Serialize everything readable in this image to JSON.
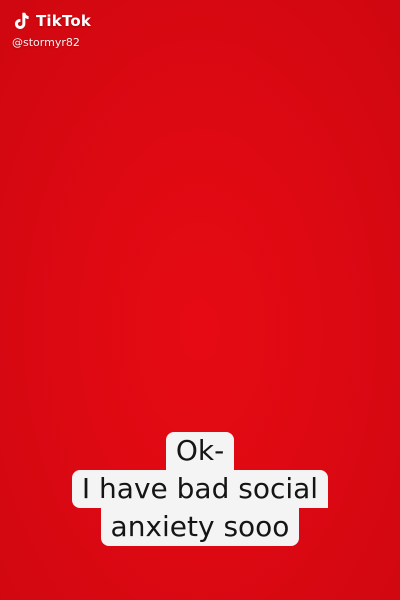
{
  "watermark": {
    "brand": "TikTok",
    "handle": "@stormyr82",
    "logo_icon": "tiktok-note-icon"
  },
  "caption": {
    "lines": [
      "Ok-",
      "I have bad social",
      "anxiety sooo"
    ]
  },
  "colors": {
    "background": "#dd0912",
    "caption_bg": "#f4f4f4",
    "caption_text": "#151515"
  }
}
